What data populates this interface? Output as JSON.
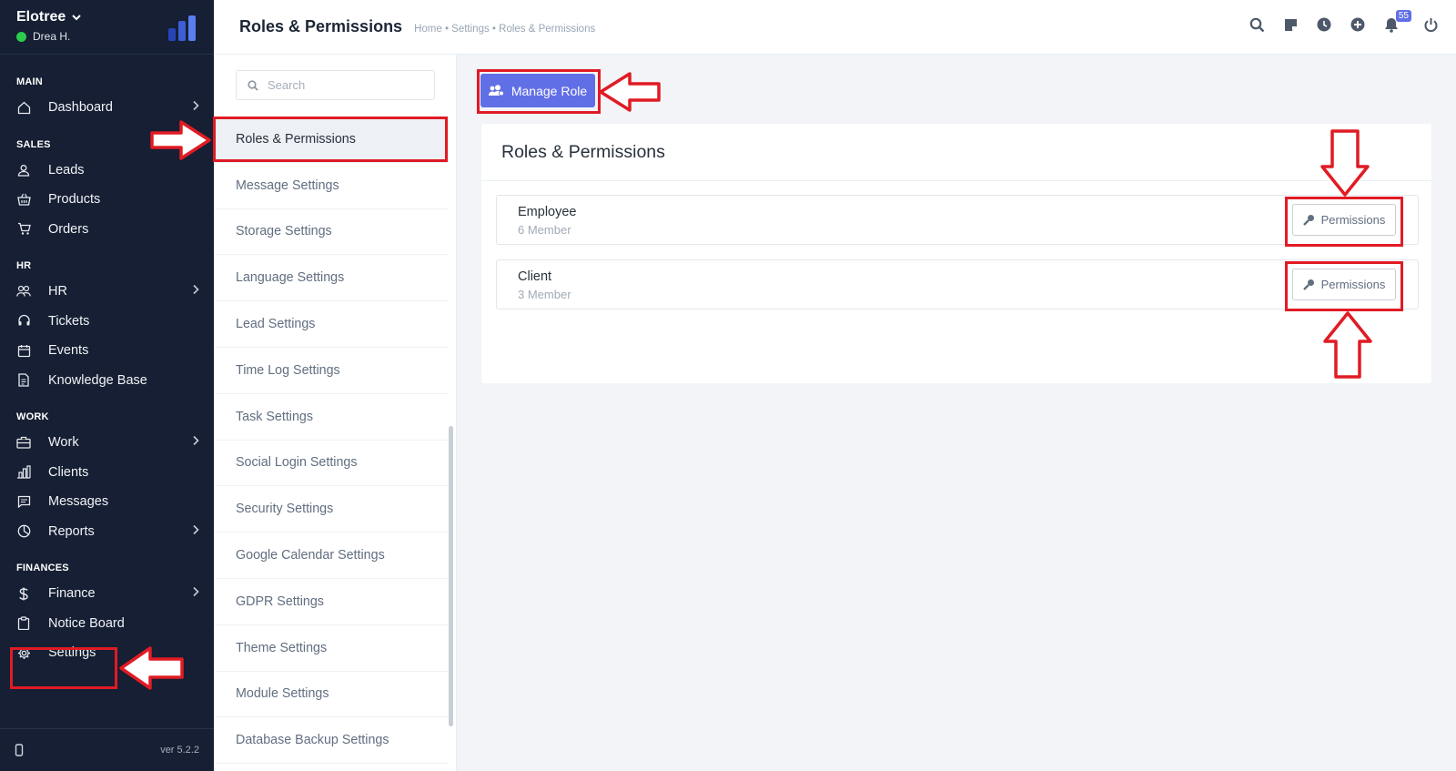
{
  "brand": {
    "name": "Elotree",
    "user": "Drea H."
  },
  "sidebar": {
    "sections": [
      {
        "title": "MAIN",
        "items": [
          {
            "label": "Dashboard",
            "icon": "home-icon",
            "chevron": true
          }
        ]
      },
      {
        "title": "SALES",
        "items": [
          {
            "label": "Leads",
            "icon": "user-icon",
            "chevron": false
          },
          {
            "label": "Products",
            "icon": "basket-icon",
            "chevron": false
          },
          {
            "label": "Orders",
            "icon": "cart-icon",
            "chevron": false
          }
        ]
      },
      {
        "title": "HR",
        "items": [
          {
            "label": "HR",
            "icon": "people-icon",
            "chevron": true
          },
          {
            "label": "Tickets",
            "icon": "headset-icon",
            "chevron": false
          },
          {
            "label": "Events",
            "icon": "calendar-icon",
            "chevron": false
          },
          {
            "label": "Knowledge Base",
            "icon": "document-icon",
            "chevron": false
          }
        ]
      },
      {
        "title": "WORK",
        "items": [
          {
            "label": "Work",
            "icon": "briefcase-icon",
            "chevron": true
          },
          {
            "label": "Clients",
            "icon": "building-icon",
            "chevron": false
          },
          {
            "label": "Messages",
            "icon": "message-icon",
            "chevron": false
          },
          {
            "label": "Reports",
            "icon": "pie-chart-icon",
            "chevron": true
          }
        ]
      },
      {
        "title": "FINANCES",
        "items": [
          {
            "label": "Finance",
            "icon": "dollar-icon",
            "chevron": true
          },
          {
            "label": "Notice Board",
            "icon": "clipboard-icon",
            "chevron": false
          },
          {
            "label": "Settings",
            "icon": "gear-icon",
            "chevron": false
          }
        ]
      }
    ],
    "version": "ver 5.2.2"
  },
  "header": {
    "title": "Roles & Permissions",
    "breadcrumb": "Home • Settings • Roles & Permissions",
    "notification_count": "55",
    "icons": [
      "search-icon",
      "sticky-note-icon",
      "clock-icon",
      "plus-circle-icon",
      "bell-icon",
      "power-icon"
    ]
  },
  "settings_menu": {
    "search_placeholder": "Search",
    "items": [
      "Roles & Permissions",
      "Message Settings",
      "Storage Settings",
      "Language Settings",
      "Lead Settings",
      "Time Log Settings",
      "Task Settings",
      "Social Login Settings",
      "Security Settings",
      "Google Calendar Settings",
      "GDPR Settings",
      "Theme Settings",
      "Module Settings",
      "Database Backup Settings"
    ],
    "active_index": 0
  },
  "main": {
    "manage_role_label": "Manage Role",
    "card_title": "Roles & Permissions",
    "roles": [
      {
        "name": "Employee",
        "members": "6 Member",
        "button": "Permissions"
      },
      {
        "name": "Client",
        "members": "3 Member",
        "button": "Permissions"
      }
    ]
  },
  "colors": {
    "sidebar_bg": "#161f33",
    "accent": "#616fe6",
    "annotation": "#e01b24",
    "online": "#2cca4d"
  }
}
